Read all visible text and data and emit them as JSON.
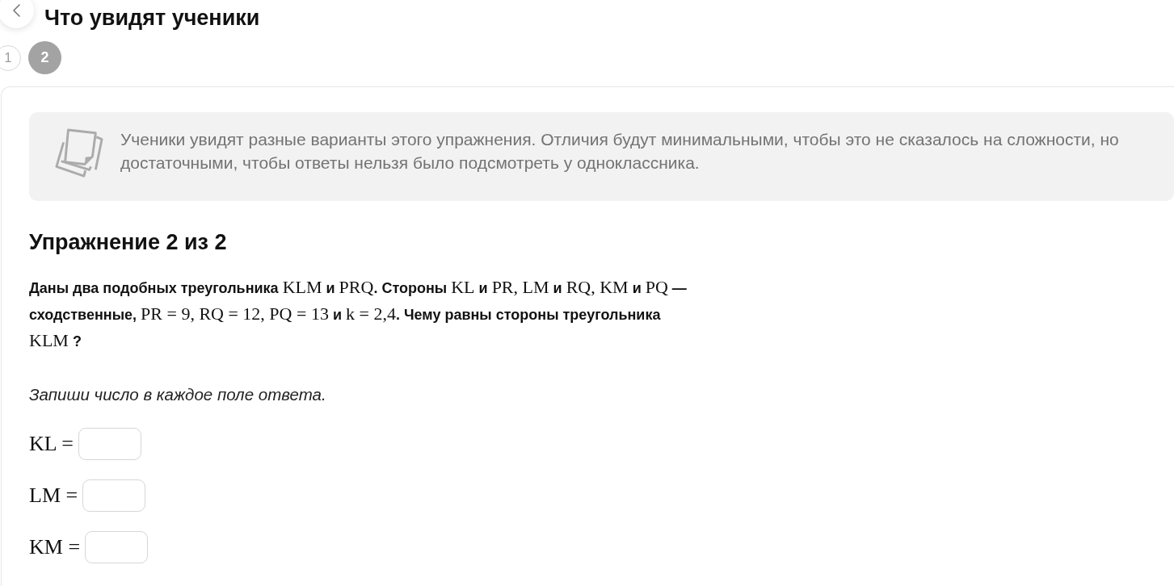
{
  "header": {
    "title": "Что увидят ученики"
  },
  "steps": [
    {
      "label": "1",
      "selected": false
    },
    {
      "label": "2",
      "selected": true
    }
  ],
  "notice": {
    "text": "Ученики увидят разные варианты этого упражнения. Отличия будут минимальными, чтобы это не сказалось на сложности, но достаточными, чтобы ответы нельзя было подсмотреть у одноклассника."
  },
  "exercise": {
    "heading": "Упражнение 2 из 2",
    "problem": [
      {
        "kind": "text",
        "text": "Даны два подобных треугольника "
      },
      {
        "kind": "math",
        "text": "KLM"
      },
      {
        "kind": "text",
        "text": " и "
      },
      {
        "kind": "math",
        "text": "PRQ"
      },
      {
        "kind": "text",
        "text": ". Стороны "
      },
      {
        "kind": "math",
        "text": "KL"
      },
      {
        "kind": "text",
        "text": " и "
      },
      {
        "kind": "math",
        "text": "PR, LM"
      },
      {
        "kind": "text",
        "text": " и "
      },
      {
        "kind": "math",
        "text": "RQ, KM"
      },
      {
        "kind": "text",
        "text": " и "
      },
      {
        "kind": "math",
        "text": "PQ"
      },
      {
        "kind": "text",
        "text": " — сходственные, "
      },
      {
        "kind": "math",
        "text": "PR = 9, RQ = 12, PQ = 13"
      },
      {
        "kind": "text",
        "text": " и "
      },
      {
        "kind": "math",
        "text": "k = 2,4"
      },
      {
        "kind": "text",
        "text": ". Чему равны стороны треугольника "
      },
      {
        "kind": "math",
        "text": "KLM"
      },
      {
        "kind": "text",
        "text": " ?"
      }
    ],
    "instruction": "Запиши число в каждое поле ответа.",
    "answers": [
      {
        "label": "KL ="
      },
      {
        "label": "LM ="
      },
      {
        "label": "KM ="
      }
    ]
  }
}
